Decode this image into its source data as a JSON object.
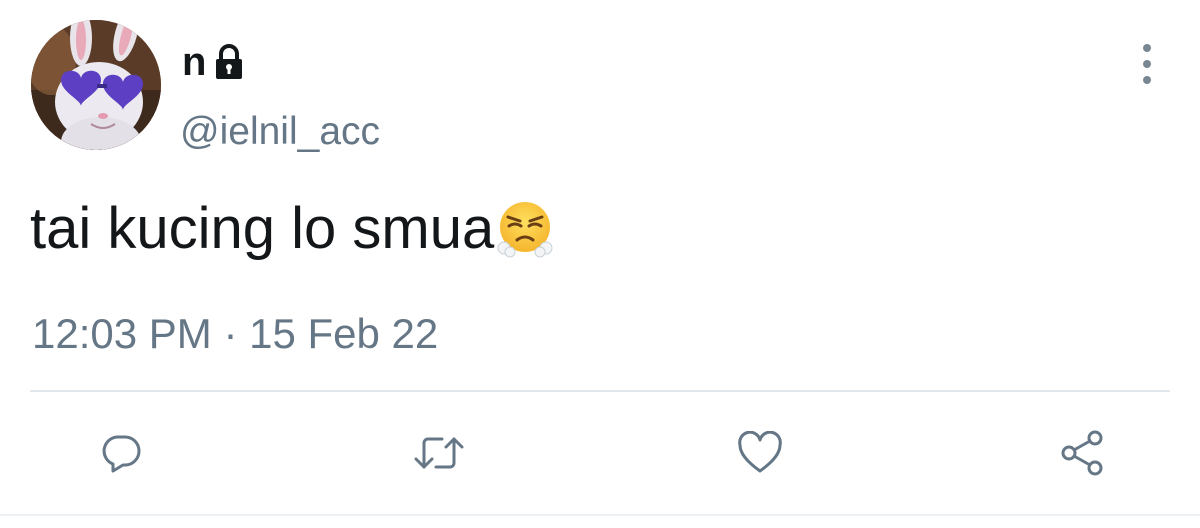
{
  "tweet": {
    "display_name": "n",
    "handle": "@ielnil_acc",
    "text": "tai kucing lo smua",
    "timestamp": "12:03 PM · 15 Feb 22"
  },
  "icons": {
    "lock": "lock-icon",
    "more": "more-vertical-icon",
    "emoji": "face-with-steam-from-nose-emoji",
    "reply": "reply-icon",
    "retweet": "retweet-icon",
    "like": "heart-icon",
    "share": "share-icon"
  },
  "colors": {
    "text_primary": "#14171a",
    "text_secondary": "#657786",
    "divider": "#e1e8ed"
  }
}
